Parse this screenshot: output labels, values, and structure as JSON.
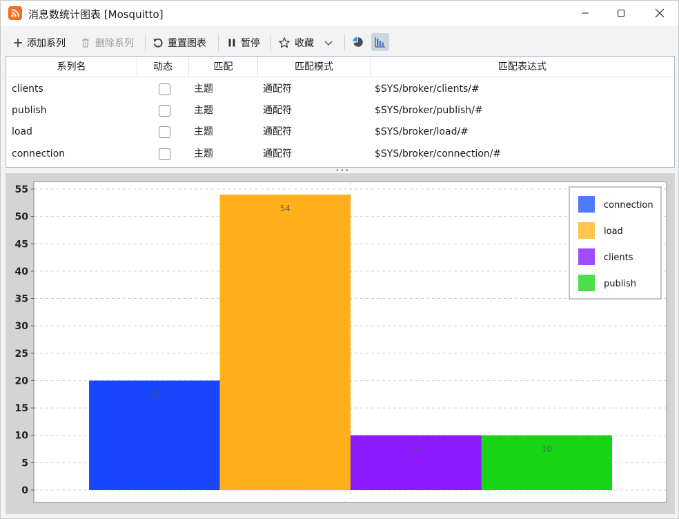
{
  "window": {
    "title": "消息数统计图表 [Mosquitto]",
    "app_icon": "rss-feed-icon",
    "brand_color": "#f26f21"
  },
  "toolbar": {
    "add_series_label": "添加系列",
    "delete_series_label": "删除系列",
    "reset_chart_label": "重置图表",
    "pause_label": "暂停",
    "favorite_label": "收藏"
  },
  "table": {
    "headers": [
      "系列名",
      "动态",
      "匹配",
      "匹配模式",
      "匹配表达式"
    ],
    "rows": [
      {
        "name": "clients",
        "dynamic": false,
        "match": "主题",
        "mode": "通配符",
        "expression": "$SYS/broker/clients/#"
      },
      {
        "name": "publish",
        "dynamic": false,
        "match": "主题",
        "mode": "通配符",
        "expression": "$SYS/broker/publish/#"
      },
      {
        "name": "load",
        "dynamic": false,
        "match": "主题",
        "mode": "通配符",
        "expression": "$SYS/broker/load/#"
      },
      {
        "name": "connection",
        "dynamic": false,
        "match": "主题",
        "mode": "通配符",
        "expression": "$SYS/broker/connection/#"
      }
    ]
  },
  "chart_data": {
    "type": "bar",
    "categories": [
      "connection",
      "load",
      "clients",
      "publish"
    ],
    "values": [
      20,
      54,
      10,
      10
    ],
    "data_labels": [
      "20",
      "54",
      "10",
      "10"
    ],
    "colors": [
      "#1947ff",
      "#ffb01a",
      "#8c19ff",
      "#17d417"
    ],
    "legend_colors": [
      "#4f79ff",
      "#ffc54d",
      "#a04cff",
      "#4cdf4c"
    ],
    "yticks": [
      0,
      5,
      10,
      15,
      20,
      25,
      30,
      35,
      40,
      45,
      50,
      55
    ],
    "ylim": [
      0,
      55
    ],
    "grid": true,
    "legend_position": "top-right",
    "title": "",
    "xlabel": "",
    "ylabel": ""
  }
}
